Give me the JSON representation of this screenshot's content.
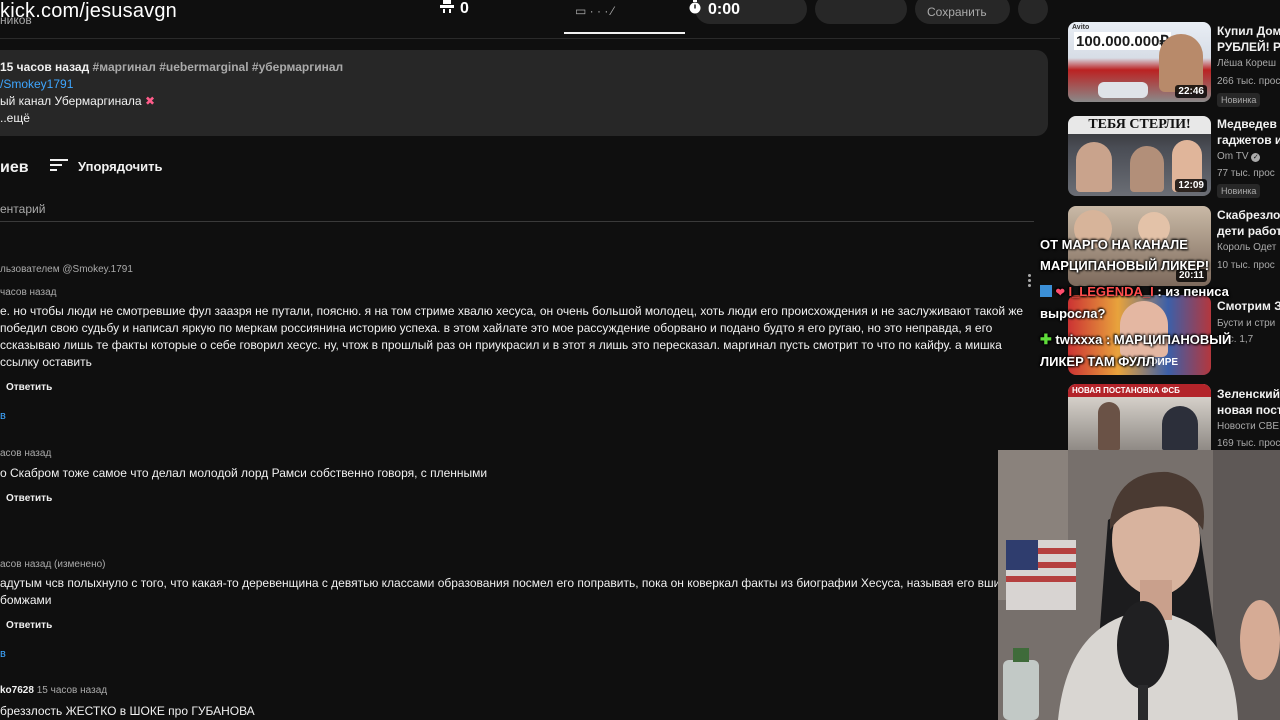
{
  "overlay": {
    "url": "kick.com/jesusavgn"
  },
  "topbar": {
    "viewers_count": "0",
    "timer": "0:00",
    "faded_label": "Сохранить"
  },
  "description": {
    "author_fragment": "ников",
    "time": "15 часов назад",
    "tags": "#маргинал #uebermarginal #убермаргинал",
    "link": "/Smokey1791",
    "line": "ый канал Убермаргинала",
    "more": "..ещё"
  },
  "comments_header": {
    "count_fragment": "иев",
    "sort_label": "Упорядочить",
    "add_comment_placeholder": "ентарий"
  },
  "comments": [
    {
      "pinned": "льзователем @Smokey.1791",
      "time": "часов назад",
      "text": "е. но чтобы люди не смотревшие фул заазря не путали, поясню. я на том стриме хвалю хесуса, он очень большой молодец, хоть люди его происхождения и не заслуживают такой же победил свою судьбу и написал яркую по меркам россиянина историю успеха. в этом хайлате это мое рассуждение оборвано и подано будто я его ругаю, но это неправда, я его ссказываю лишь те факты которые о себе говорил хесус. ну, чтож в прошлый раз он приукрасил и в этот я лишь это пересказал. маргинал пусть смотрит то что по кайфу. а мишка ссылку оставить",
      "reply": "Ответить",
      "replies": "в"
    },
    {
      "time": "асов назад",
      "text": "о Скабром тоже самое что делал молодой лорд Рамси собственно говоря, с пленными",
      "reply": "Ответить"
    },
    {
      "time": "асов назад (изменено)",
      "text": "адутым чсв полыхнуло с того, что какая-то деревенщина с девятью классами образования посмел его поправить, пока он коверкал факты из биографии Хесуса, называя его вшимися бомжами",
      "reply": "Ответить",
      "replies": "в"
    },
    {
      "username": "ko7628",
      "time": "15 часов назад",
      "text": "бреззлость ЖЕСТКО в ШОКЕ про ГУБАНОВА"
    }
  ],
  "videos": [
    {
      "title": "Купил Дом",
      "title2": "РУБЛЕЙ! Р",
      "channel": "Лёша Кореш",
      "views": "266 тыс. прос",
      "badge": "Новинка",
      "duration": "22:46",
      "thumb_text": "100.000.000₽",
      "thumb_logo": "Avito"
    },
    {
      "title": "Медведев",
      "title2": "гаджетов и",
      "channel": "Om TV",
      "views": "77 тыс. прос",
      "badge": "Новинка",
      "duration": "12:09",
      "thumb_text": "ТЕБЯ СТЕРЛИ!"
    },
    {
      "title": "Скабрезло",
      "title2": "дети работ",
      "channel": "Король Одет",
      "views": "10 тыс. прос",
      "duration": "20:11"
    },
    {
      "title": "Смотрим З",
      "channel": "Бусти и стри",
      "views": "тыс. 1,7"
    },
    {
      "title": "Зеленский",
      "title2": "новая пост",
      "channel": "Новости СВЕ",
      "views": "169 тыс. прос",
      "thumb_text": "НОВАЯ ПОСТАНОВКА ФСБ"
    }
  ],
  "chat": {
    "line1": "ОТ МАРГО НА КАНАЛЕ",
    "line2": "МАРЦИПАНОВЫЙ ЛИКЕР!",
    "msg1_user": "I_LEGENDA_I",
    "msg1_text": ": из пениса",
    "msg1_cont": "выросла?",
    "msg2_user": "twixxxa",
    "msg2_text": ": МАРЦИПАНОВЫЙ",
    "msg2_cont": "ЛИКЕР ТАМ ФУЛЛ",
    "ghost_text": "ЭФИРЕ"
  },
  "colors": {
    "background": "#0f0f0f",
    "panel": "#272727",
    "link": "#3ea6ff",
    "muted": "#aaaaaa",
    "chat_user1": "#ff4d4d",
    "chat_user2": "#ffffff"
  }
}
